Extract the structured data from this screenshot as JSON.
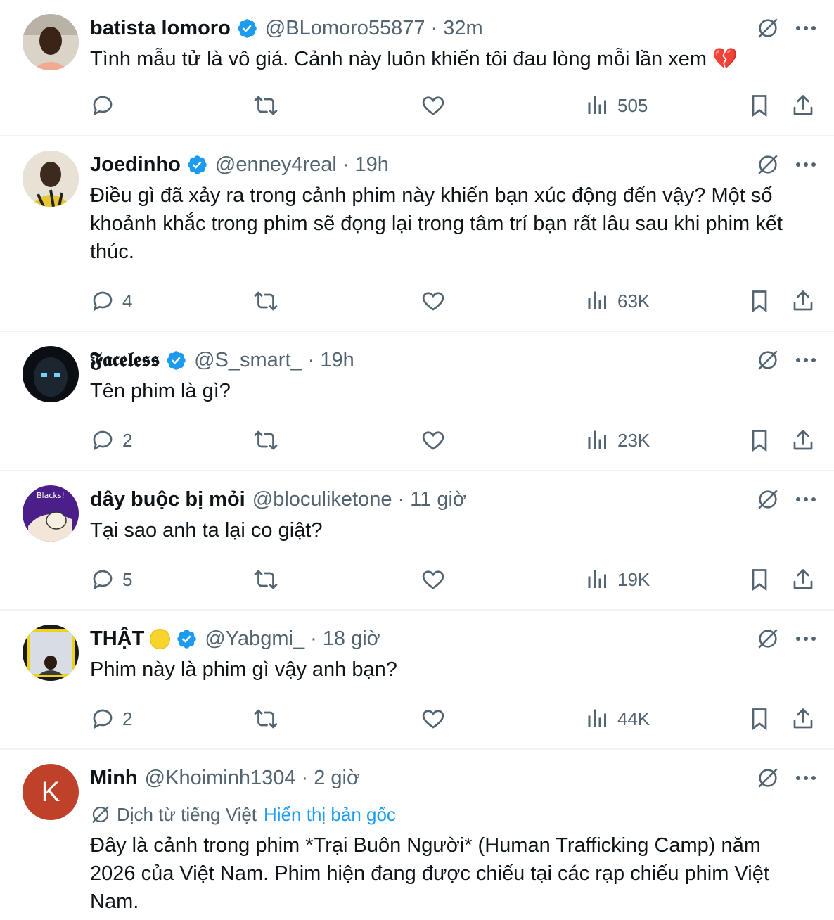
{
  "colors": {
    "text": "#0f1419",
    "secondary": "#536471",
    "verified": "#1d9bf0",
    "link": "#1d9bf0",
    "divider": "#eff3f4"
  },
  "tweets": [
    {
      "name": "batista lomoro",
      "handle": "@BLomoro55877",
      "sep": "·",
      "time": "32m",
      "text": "Tình mẫu tử là vô giá. Cảnh này luôn khiến tôi đau lòng mỗi lần xem 💔",
      "replies": "",
      "views": "505",
      "avatar": "photo"
    },
    {
      "name": "Joedinho",
      "handle": "@enney4real",
      "sep": "·",
      "time": "19h",
      "text": "Điều gì đã xảy ra trong cảnh phim này khiến bạn xúc động đến vậy? Một số khoảnh khắc trong phim sẽ đọng lại trong tâm trí bạn rất lâu sau khi phim kết thúc.",
      "replies": "4",
      "views": "63K",
      "avatar": "photo"
    },
    {
      "name": "𝕱𝖆𝖈𝖊𝖑𝖊𝖘𝖘",
      "handle": "@S_smart_",
      "sep": "·",
      "time": "19h",
      "text": "Tên phim là gì?",
      "replies": "2",
      "views": "23K",
      "avatar": "photo"
    },
    {
      "name": "dây buộc bị mỏi",
      "handle": "@bloculiketone",
      "sep": "·",
      "time": "11 giờ",
      "text": "Tại sao anh ta lại co giật?",
      "replies": "5",
      "views": "19K",
      "avatar": "drawing",
      "avatar_text": "Blacks!"
    },
    {
      "name": "THẬT",
      "handle": "@Yabgmi_",
      "sep": "·",
      "time": "18 giờ",
      "text": "Phim này là phim gì vậy anh bạn?",
      "replies": "2",
      "views": "44K",
      "avatar": "photo"
    },
    {
      "name": "Minh",
      "handle": "@Khoiminh1304",
      "sep": "·",
      "time": "2 giờ",
      "translate_label": "Dịch từ tiếng Việt",
      "show_original": "Hiển thị bản gốc",
      "text": "Đây là cảnh trong phim *Trại Buôn Người* (Human Trafficking Camp) năm 2026 của Việt Nam. Phim hiện đang được chiếu tại các rạp chiếu phim Việt Nam.",
      "avatar_letter": "K",
      "avatar_color": "#c0412a"
    }
  ],
  "icons": {
    "reply": "reply-icon",
    "repost": "repost-icon",
    "like": "heart-icon",
    "views": "views-icon",
    "bookmark": "bookmark-icon",
    "share": "share-icon",
    "grok": "grok-icon",
    "more": "more-icon",
    "verified": "verified-badge-icon"
  }
}
